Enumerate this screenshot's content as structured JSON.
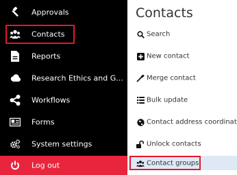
{
  "sidebar": {
    "items": [
      {
        "label": "Approvals",
        "icon": "gavel-icon"
      },
      {
        "label": "Contacts",
        "icon": "users-icon"
      },
      {
        "label": "Reports",
        "icon": "file-icon"
      },
      {
        "label": "Research Ethics and G...",
        "icon": "cloud-icon"
      },
      {
        "label": "Workflows",
        "icon": "share-icon"
      },
      {
        "label": "Forms",
        "icon": "form-icon"
      },
      {
        "label": "System settings",
        "icon": "gears-icon"
      },
      {
        "label": "Log out",
        "icon": "power-icon"
      }
    ]
  },
  "submenu": {
    "title": "Contacts",
    "items": [
      {
        "label": "Search",
        "icon": "search-icon"
      },
      {
        "label": "New contact",
        "icon": "plus-square-icon"
      },
      {
        "label": "Merge contact",
        "icon": "merge-icon"
      },
      {
        "label": "Bulk update",
        "icon": "list-icon"
      },
      {
        "label": "Contact address coordinate",
        "icon": "globe-icon"
      },
      {
        "label": "Unlock contacts",
        "icon": "unlock-icon"
      },
      {
        "label": "Contact groups",
        "icon": "users-icon"
      }
    ]
  },
  "colors": {
    "sidebar_bg": "#000000",
    "logout_bg": "#e8253c",
    "highlight_border": "#e4182a",
    "selected_bg": "#dfe9f6"
  }
}
